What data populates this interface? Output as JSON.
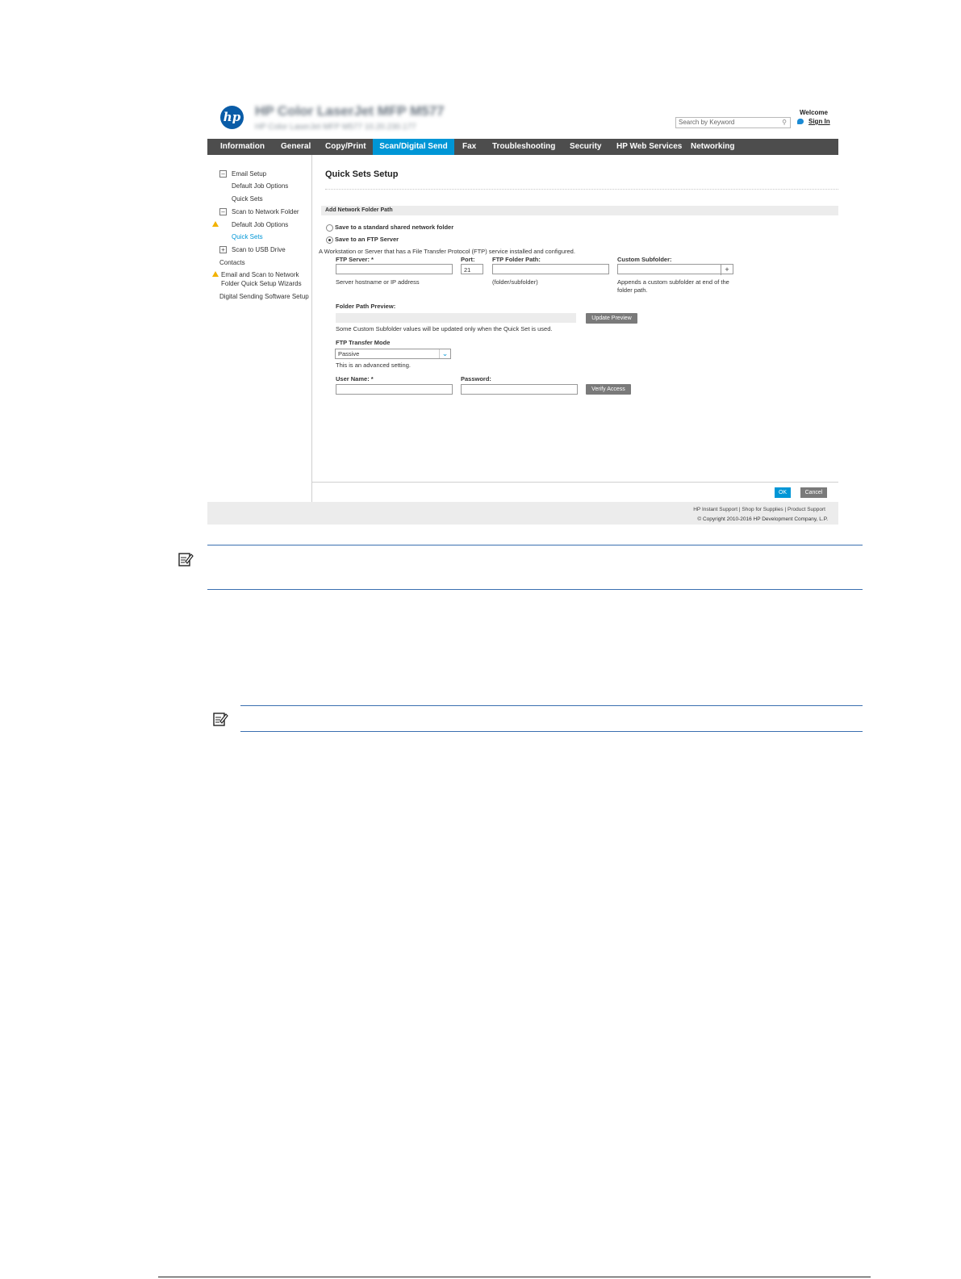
{
  "header": {
    "title": "HP Color LaserJet MFP M577",
    "subtitle": "HP Color LaserJet MFP M577   10.20.230.177",
    "welcome": "Welcome",
    "search_placeholder": "Search by Keyword",
    "sign_in": "Sign In",
    "logo_text": "hp"
  },
  "nav": {
    "tabs": [
      "Information",
      "General",
      "Copy/Print",
      "Scan/Digital Send",
      "Fax",
      "Troubleshooting",
      "Security",
      "HP Web Services",
      "Networking"
    ],
    "active": "Scan/Digital Send"
  },
  "sidebar": {
    "items": [
      "Email Setup",
      "Default Job Options",
      "Quick Sets",
      "Scan to Network Folder",
      "Default Job Options",
      "Quick Sets",
      "Scan to USB Drive",
      "Contacts",
      "Email and Scan to Network",
      "Folder Quick Setup Wizards",
      "Digital Sending Software Setup"
    ]
  },
  "main": {
    "title": "Quick Sets Setup",
    "section": "Add Network Folder Path",
    "radio_shared": "Save to a standard shared network folder",
    "radio_ftp": "Save to an FTP Server",
    "ftp_desc": "A Workstation or Server that has a File Transfer Protocol (FTP) service installed and configured.",
    "ftp_server_label": "FTP Server: *",
    "port_label": "Port:",
    "port_value": "21",
    "folder_path_label": "FTP Folder Path:",
    "custom_subfolder_label": "Custom Subfolder:",
    "plus": "+",
    "server_hint": "Server hostname or IP address",
    "folder_hint": "(folder/subfolder)",
    "subfolder_hint_1": "Appends a custom subfolder at end of the",
    "subfolder_hint_2": "folder path.",
    "preview_label": "Folder Path Preview:",
    "update_preview": "Update Preview",
    "preview_note": "Some Custom Subfolder values will be updated only when the Quick Set is used.",
    "transfer_mode_label": "FTP Transfer Mode",
    "transfer_mode_value": "Passive",
    "advanced_note": "This is an advanced setting.",
    "username_label": "User Name: *",
    "password_label": "Password:",
    "verify_access": "Verify Access",
    "ok": "OK",
    "cancel": "Cancel"
  },
  "footer": {
    "link1": "HP Instant Support",
    "link2": "Shop for Supplies",
    "link3": "Product Support",
    "separator": "|",
    "copyright": "© Copyright 2010-2016 HP Development Company, L.P."
  },
  "colors": {
    "nav_bg": "#4d4d4d",
    "active_tab": "#0096d6",
    "note_rule": "#3a6fb0",
    "warning": "#f2b200"
  }
}
